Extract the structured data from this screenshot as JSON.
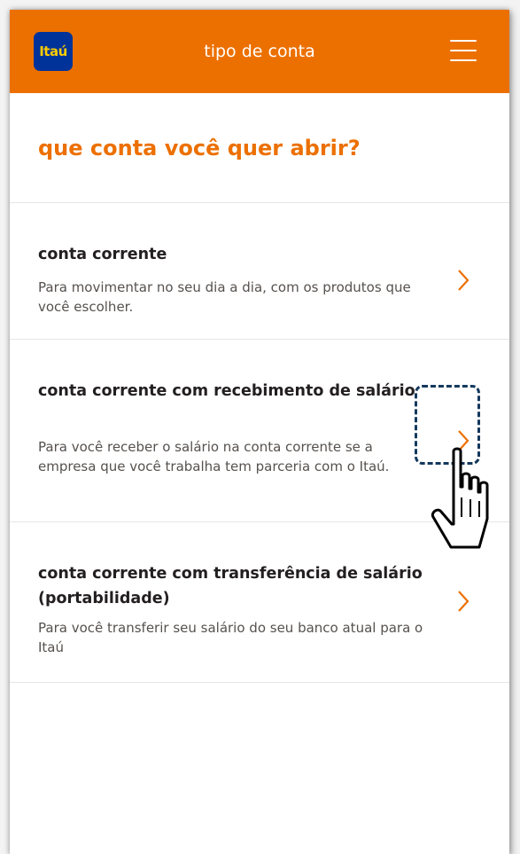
{
  "header": {
    "logo_text": "Itaú",
    "title": "tipo de conta",
    "menu_icon": "hamburger-menu-icon"
  },
  "page": {
    "title": "que conta você quer abrir?"
  },
  "options": [
    {
      "title": "conta corrente",
      "description": "Para movimentar no seu dia a dia, com os produtos que você escolher."
    },
    {
      "title": "conta corrente com recebimento de salário",
      "description": "Para você receber o salário na conta corrente se a empresa que você trabalha tem parceria com o Itaú."
    },
    {
      "title": "conta corrente com transferência de salário (portabilidade)",
      "description": "Para você transferir seu salário do seu banco atual para o Itaú"
    }
  ],
  "colors": {
    "brand_orange": "#ec7000",
    "logo_blue": "#003399",
    "logo_yellow": "#ffcc00",
    "highlight_box": "#14385e"
  },
  "icons": {
    "chevron": "chevron-right-icon",
    "pointer": "hand-pointer-cursor-icon"
  }
}
